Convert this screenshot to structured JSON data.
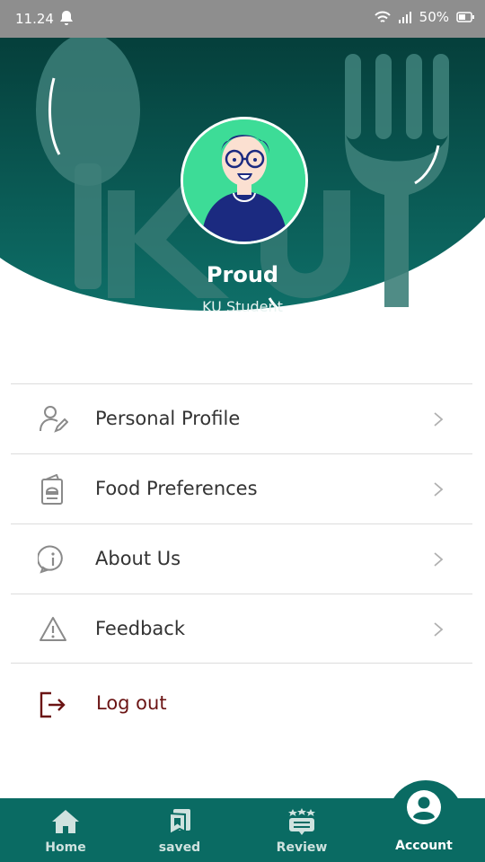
{
  "status_bar": {
    "time": "11.24",
    "battery": "50%"
  },
  "profile": {
    "name": "Proud",
    "role": "KU Student"
  },
  "menu": {
    "items": [
      {
        "label": "Personal Profile",
        "icon": "user-edit-icon"
      },
      {
        "label": "Food Preferences",
        "icon": "menu-card-icon"
      },
      {
        "label": "About Us",
        "icon": "info-icon"
      },
      {
        "label": "Feedback",
        "icon": "warning-icon"
      }
    ],
    "logout": {
      "label": "Log out",
      "icon": "logout-icon"
    }
  },
  "nav": {
    "items": [
      {
        "label": "Home",
        "icon": "home-icon"
      },
      {
        "label": "saved",
        "icon": "bookmark-icon"
      },
      {
        "label": "Review",
        "icon": "review-icon"
      },
      {
        "label": "Account",
        "icon": "account-icon"
      }
    ],
    "active": "Account"
  },
  "colors": {
    "primary": "#0a6b63",
    "logout": "#6b1414",
    "avatar_bg": "#3ddc97"
  }
}
